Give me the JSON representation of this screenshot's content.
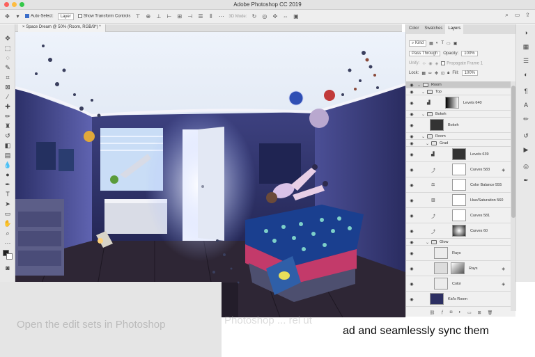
{
  "window": {
    "title": "Adobe Photoshop CC 2019"
  },
  "options_bar": {
    "auto_select_label": "Auto-Select:",
    "auto_select_value": "Layer",
    "transform_controls_label": "Show Transform Controls",
    "mode_3d_label": "3D Mode:"
  },
  "document": {
    "tab_title": "Space Dream @ 50% (Room, RGB/8*) *"
  },
  "panel": {
    "tabs": [
      "Color",
      "Swatches",
      "Layers"
    ],
    "filter_kind": "Kind",
    "blend_mode": "Pass Through",
    "opacity_label": "Opacity:",
    "opacity_value": "100%",
    "unify_label": "Unify:",
    "propagate_label": "Propagate Frame 1",
    "lock_label": "Lock:",
    "fill_label": "Fill:",
    "fill_value": "100%"
  },
  "layers": [
    {
      "name": "Room",
      "kind": "group"
    },
    {
      "name": "Top",
      "kind": "group"
    },
    {
      "name": "Levels 640",
      "kind": "adjustment"
    },
    {
      "name": "Bokeh",
      "kind": "group"
    },
    {
      "name": "Bokeh",
      "kind": "pixel"
    },
    {
      "name": "Room",
      "kind": "group"
    },
    {
      "name": "Grad",
      "kind": "group"
    },
    {
      "name": "Levels 639",
      "kind": "adjustment"
    },
    {
      "name": "Curves 583",
      "kind": "adjustment"
    },
    {
      "name": "Color Balance 555",
      "kind": "adjustment"
    },
    {
      "name": "Hue/Saturation 560",
      "kind": "adjustment"
    },
    {
      "name": "Curves 581",
      "kind": "adjustment"
    },
    {
      "name": "Curves 60",
      "kind": "adjustment"
    },
    {
      "name": "Glow",
      "kind": "group"
    },
    {
      "name": "Rays",
      "kind": "pixel"
    },
    {
      "name": "Rays",
      "kind": "smart"
    },
    {
      "name": "Color",
      "kind": "pixel"
    },
    {
      "name": "Kid's Room",
      "kind": "pixel"
    }
  ],
  "page": {
    "ghost_left": "Open the edit sets in Photoshop",
    "ghost_right": "Photoshop ... rel ut",
    "caption": "ad and seamlessly sync them"
  },
  "colors": {
    "panel_bg": "#f0f0f0",
    "selected_layer": "#c8c8c8",
    "canvas_night": "#1b1c37"
  }
}
